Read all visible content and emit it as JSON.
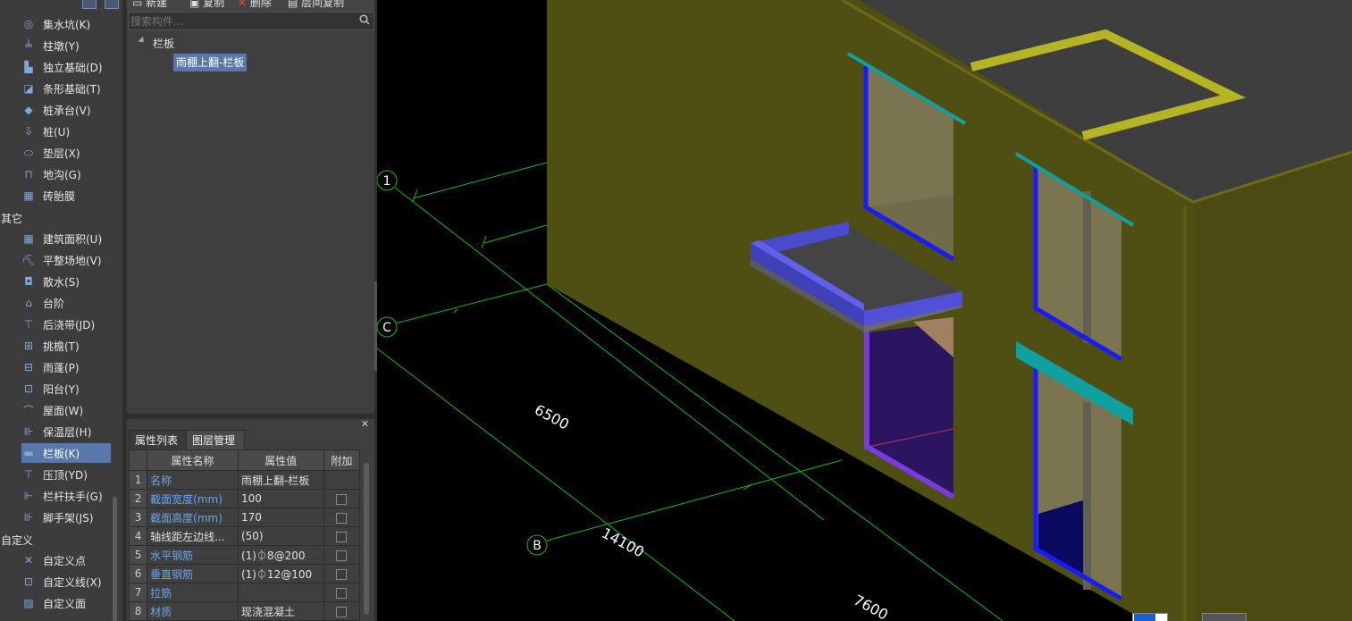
{
  "left_nav": {
    "items": [
      {
        "label": "集水坑(K)",
        "icon": "sump-icon"
      },
      {
        "label": "柱墩(Y)",
        "icon": "column-pier-icon"
      },
      {
        "label": "独立基础(D)",
        "icon": "isolated-footing-icon"
      },
      {
        "label": "条形基础(T)",
        "icon": "strip-footing-icon"
      },
      {
        "label": "桩承台(V)",
        "icon": "pile-cap-icon"
      },
      {
        "label": "桩(U)",
        "icon": "pile-icon"
      },
      {
        "label": "垫层(X)",
        "icon": "cushion-icon"
      },
      {
        "label": "地沟(G)",
        "icon": "trench-icon"
      },
      {
        "label": "砖胎膜",
        "icon": "brick-mold-icon"
      },
      {
        "label": "建筑面积(U)",
        "icon": "building-area-icon"
      },
      {
        "label": "平整场地(V)",
        "icon": "site-leveling-icon"
      },
      {
        "label": "散水(S)",
        "icon": "apron-icon"
      },
      {
        "label": "台阶",
        "icon": "steps-icon"
      },
      {
        "label": "后浇带(JD)",
        "icon": "post-cast-strip-icon"
      },
      {
        "label": "挑檐(T)",
        "icon": "eave-icon"
      },
      {
        "label": "雨蓬(P)",
        "icon": "canopy-icon"
      },
      {
        "label": "阳台(Y)",
        "icon": "balcony-icon"
      },
      {
        "label": "屋面(W)",
        "icon": "roof-icon"
      },
      {
        "label": "保温层(H)",
        "icon": "insulation-icon"
      },
      {
        "label": "栏板(K)",
        "icon": "parapet-panel-icon"
      },
      {
        "label": "压顶(YD)",
        "icon": "coping-icon"
      },
      {
        "label": "栏杆扶手(G)",
        "icon": "railing-icon"
      },
      {
        "label": "脚手架(JS)",
        "icon": "scaffold-icon"
      },
      {
        "label": "自定义点",
        "icon": "custom-point-icon"
      },
      {
        "label": "自定义线(X)",
        "icon": "custom-line-icon"
      },
      {
        "label": "自定义面",
        "icon": "custom-face-icon"
      }
    ],
    "groups": {
      "other": "其它",
      "custom": "自定义"
    }
  },
  "toolbar": {
    "new": "新建",
    "copy": "复制",
    "delete": "删除",
    "floor_copy": "层间复制"
  },
  "search": {
    "placeholder": "搜索构件..."
  },
  "tree": {
    "root": "栏板",
    "child": "雨棚上翻-栏板"
  },
  "properties": {
    "tabs": [
      "属性列表",
      "图层管理"
    ],
    "headers": [
      "属性名称",
      "属性值",
      "附加"
    ],
    "rows": [
      {
        "num": "1",
        "name": "名称",
        "value": "雨棚上翻-栏板",
        "blue": true,
        "check": false
      },
      {
        "num": "2",
        "name": "截面宽度(mm)",
        "value": "100",
        "blue": true,
        "check": true
      },
      {
        "num": "3",
        "name": "截面高度(mm)",
        "value": "170",
        "blue": true,
        "check": true
      },
      {
        "num": "4",
        "name": "轴线距左边线...",
        "value": "(50)",
        "blue": false,
        "check": true
      },
      {
        "num": "5",
        "name": "水平钢筋",
        "value": "(1)⏀8@200",
        "blue": true,
        "check": true
      },
      {
        "num": "6",
        "name": "垂直钢筋",
        "value": "(1)⏀12@100",
        "blue": true,
        "check": true
      },
      {
        "num": "7",
        "name": "拉筋",
        "value": "",
        "blue": true,
        "check": true
      },
      {
        "num": "8",
        "name": "材质",
        "value": "现浇混凝土",
        "blue": true,
        "check": true
      }
    ]
  },
  "viewport": {
    "axis_labels": [
      "1",
      "C",
      "B"
    ],
    "dimensions": [
      "6500",
      "14100",
      "7600"
    ]
  },
  "colors": {
    "accent": "#5778a8",
    "grid": "#19c219",
    "wall": "#4e4e14",
    "roof": "#3e3e3e",
    "window_frame": "#1a1aff",
    "canopy": "#4545b8"
  }
}
